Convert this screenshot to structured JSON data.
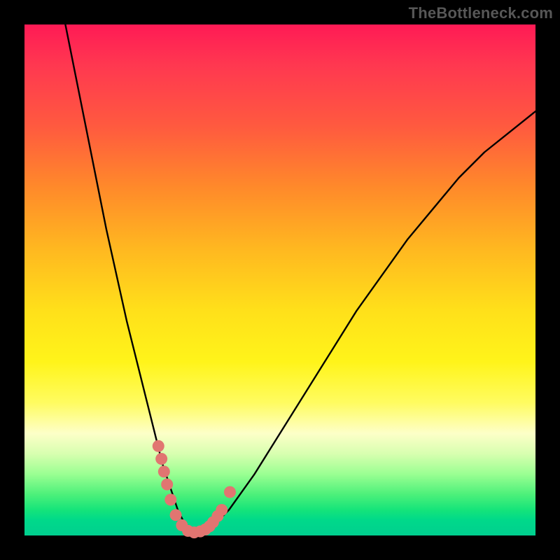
{
  "watermark": "TheBottleneck.com",
  "chart_data": {
    "type": "line",
    "title": "",
    "xlabel": "",
    "ylabel": "",
    "xlim": [
      0,
      100
    ],
    "ylim": [
      0,
      100
    ],
    "grid": false,
    "legend": false,
    "series": [
      {
        "name": "bottleneck-curve",
        "x": [
          8,
          10,
          12,
          14,
          16,
          18,
          20,
          22,
          24,
          26,
          27,
          28,
          29,
          30,
          31,
          32,
          33,
          34,
          35,
          37,
          40,
          45,
          50,
          55,
          60,
          65,
          70,
          75,
          80,
          85,
          90,
          95,
          100
        ],
        "y": [
          100,
          90,
          80,
          70,
          60,
          51,
          42,
          34,
          26,
          18,
          14,
          11,
          8,
          5,
          3,
          1.5,
          0.8,
          0.5,
          0.7,
          2,
          5,
          12,
          20,
          28,
          36,
          44,
          51,
          58,
          64,
          70,
          75,
          79,
          83
        ]
      }
    ],
    "markers": {
      "name": "highlight-dots",
      "color": "#e17571",
      "points_xy": [
        [
          26.2,
          17.5
        ],
        [
          26.8,
          15.0
        ],
        [
          27.3,
          12.5
        ],
        [
          27.9,
          10.0
        ],
        [
          28.6,
          7.0
        ],
        [
          29.6,
          4.0
        ],
        [
          30.8,
          2.0
        ],
        [
          32.0,
          0.9
        ],
        [
          33.2,
          0.6
        ],
        [
          34.4,
          0.8
        ],
        [
          35.4,
          1.2
        ],
        [
          36.2,
          1.8
        ],
        [
          36.9,
          2.6
        ],
        [
          37.8,
          3.8
        ],
        [
          38.6,
          5.0
        ],
        [
          40.2,
          8.5
        ]
      ]
    }
  }
}
